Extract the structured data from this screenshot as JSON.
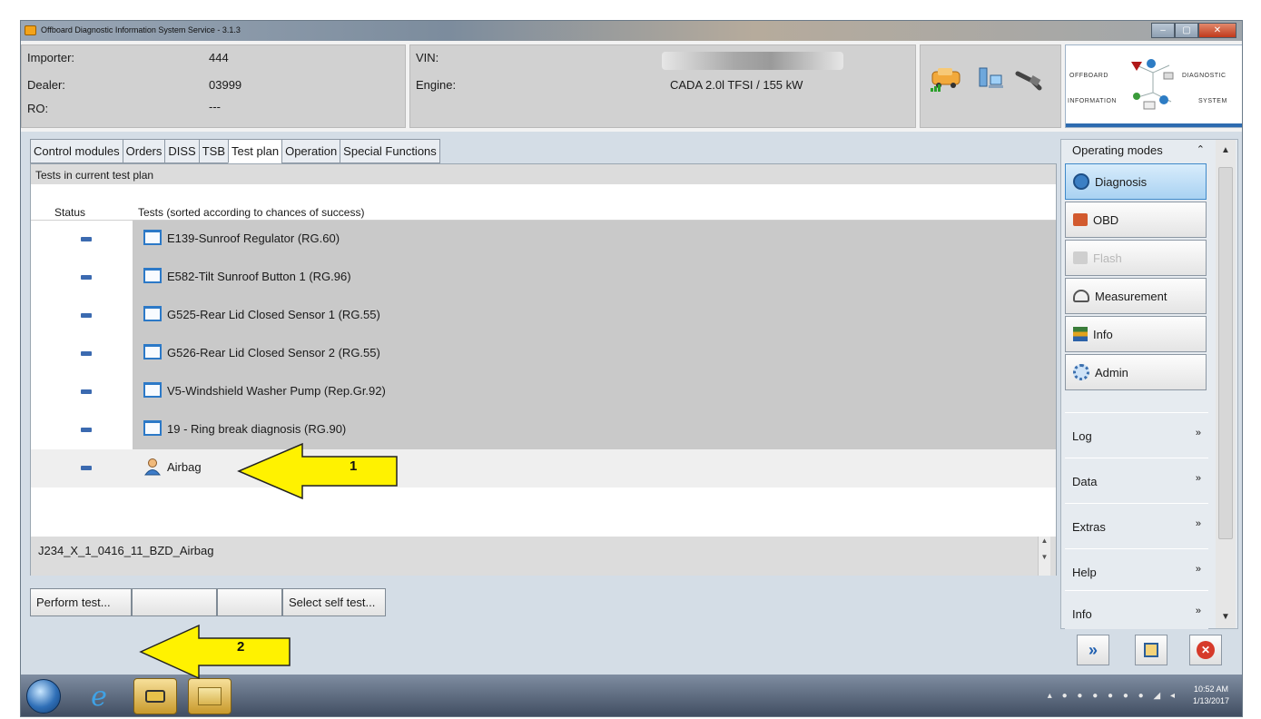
{
  "window": {
    "title": "Offboard Diagnostic Information System Service - 3.1.3",
    "buttons": [
      "–",
      "▢",
      "✕"
    ]
  },
  "header": {
    "importer_label": "Importer:",
    "importer_value": "444",
    "dealer_label": "Dealer:",
    "dealer_value": "03999",
    "ro_label": "RO:",
    "ro_value": "---",
    "vin_label": "VIN:",
    "engine_label": "Engine:",
    "engine_value": "CADA 2.0l TFSI / 155 kW",
    "icons": [
      "car-connection-icon",
      "network-icon",
      "cable-icon"
    ]
  },
  "logo": {
    "word_1": "OFFBOARD",
    "word_2": "DIAGNOSTIC",
    "word_3": "INFORMATION",
    "word_4": "SYSTEM"
  },
  "tabs": [
    "Control modules",
    "Orders",
    "DISS",
    "TSB",
    "Test plan",
    "Operation",
    "Special Functions"
  ],
  "active_tab": "Test plan",
  "panel": {
    "title": "Tests in current test plan",
    "col_status": "Status",
    "col_tests": "Tests (sorted according to chances of success)"
  },
  "tests": [
    {
      "label": "E139-Sunroof Regulator (RG.60)",
      "icon": "document-icon"
    },
    {
      "label": "E582-Tilt Sunroof Button 1 (RG.96)",
      "icon": "document-icon"
    },
    {
      "label": "G525-Rear Lid Closed Sensor 1 (RG.55)",
      "icon": "document-icon"
    },
    {
      "label": "G526-Rear Lid Closed Sensor 2 (RG.55)",
      "icon": "document-icon"
    },
    {
      "label": "V5-Windshield Washer Pump (Rep.Gr.92)",
      "icon": "document-icon"
    },
    {
      "label": "19 - Ring break diagnosis (RG.90)",
      "icon": "document-icon"
    },
    {
      "label": "Airbag",
      "icon": "person-icon",
      "selected": true
    }
  ],
  "footer": {
    "selected_code": "J234_X_1_0416_11_BZD_Airbag"
  },
  "bottom_buttons": {
    "perform": "Perform test...",
    "self_test": "Select self test..."
  },
  "sidebar": {
    "operating_modes": "Operating modes",
    "modes": [
      {
        "label": "Diagnosis",
        "active": true
      },
      {
        "label": "OBD"
      },
      {
        "label": "Flash",
        "disabled": true
      },
      {
        "label": "Measurement"
      },
      {
        "label": "Info"
      },
      {
        "label": "Admin"
      }
    ],
    "sections": [
      "Log",
      "Data",
      "Extras",
      "Help",
      "Info"
    ]
  },
  "annotations": {
    "arrow_1": "1",
    "arrow_2": "2",
    "color": "#fff200"
  },
  "taskbar": {
    "time": "10:52 AM",
    "date": "1/13/2017"
  }
}
